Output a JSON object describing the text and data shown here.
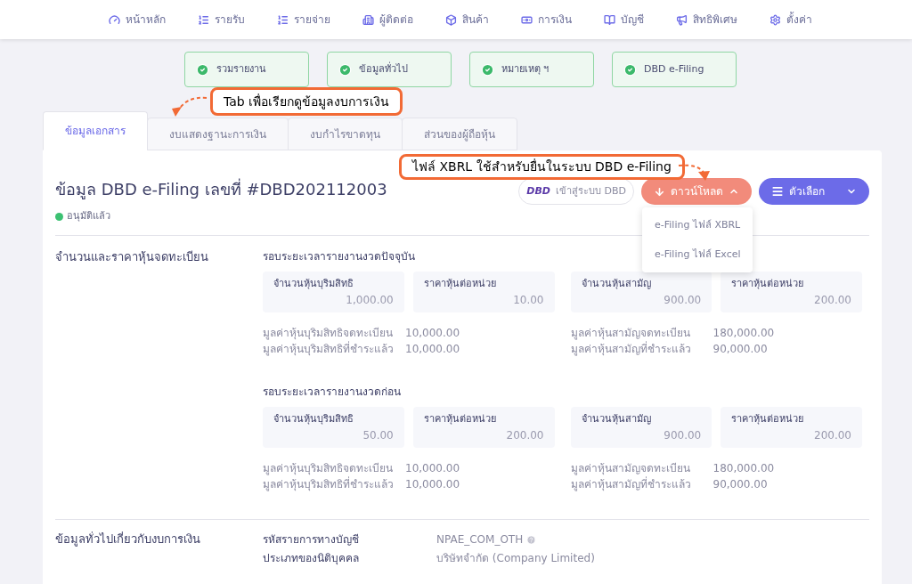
{
  "nav": [
    {
      "label": "หน้าหลัก"
    },
    {
      "label": "รายรับ"
    },
    {
      "label": "รายจ่าย"
    },
    {
      "label": "ผู้ติดต่อ"
    },
    {
      "label": "สินค้า"
    },
    {
      "label": "การเงิน"
    },
    {
      "label": "บัญชี"
    },
    {
      "label": "สิทธิพิเศษ"
    },
    {
      "label": "ตั้งค่า"
    }
  ],
  "steps": [
    {
      "label": "รวมรายงาน",
      "done": true
    },
    {
      "label": "ข้อมูลทั่วไป",
      "done": true
    },
    {
      "label": "หมายเหตุ ฯ",
      "done": true
    },
    {
      "label": "DBD e-Filing",
      "done": true
    }
  ],
  "callouts": [
    {
      "text": "Tab เพื่อเรียกดูข้อมูลงบการเงิน"
    },
    {
      "text": "ไฟล์ XBRL ใช้สำหรับยื่นในระบบ DBD e-Filing"
    }
  ],
  "tabs": [
    {
      "label": "ข้อมูลเอกสาร",
      "selected": true
    },
    {
      "label": "งบแสดงฐานะการเงิน",
      "selected": false
    },
    {
      "label": "งบกำไรขาดทุน",
      "selected": false
    },
    {
      "label": "ส่วนของผู้ถือหุ้น",
      "selected": false
    }
  ],
  "document": {
    "title": "ข้อมูล DBD e-Filing เลขที่ #DBD202112003",
    "status": {
      "label": "อนุมัติแล้ว",
      "color": "#3cc172"
    },
    "dbd_button": {
      "logo": "DBD",
      "label": "เข้าสู่ระบบ DBD"
    },
    "download_button": {
      "label": "ดาวน์โหลด",
      "expanded": true
    },
    "options_button": {
      "label": "ตัวเลือก",
      "expanded": false
    },
    "download_menu": [
      {
        "label": "e-Filing ไฟล์ XBRL"
      },
      {
        "label": "e-Filing ไฟล์ Excel"
      }
    ]
  },
  "share_section": {
    "title": "จำนวนและราคาหุ้นจดทะเบียน",
    "periods": [
      {
        "heading": "รอบระยะเวลารายงานงวดปัจจุบัน",
        "groups": [
          {
            "boxes": [
              {
                "label": "จำนวนหุ้นบุริมสิทธิ",
                "value": "1,000.00"
              },
              {
                "label": "ราคาหุ้นต่อหน่วย",
                "value": "10.00"
              }
            ],
            "rows": [
              {
                "label": "มูลค่าหุ้นบุริมสิทธิจดทะเบียน",
                "value": "10,000.00"
              },
              {
                "label": "มูลค่าหุ้นบุริมสิทธิที่ชำระแล้ว",
                "value": "10,000.00"
              }
            ]
          },
          {
            "boxes": [
              {
                "label": "จำนวนหุ้นสามัญ",
                "value": "900.00"
              },
              {
                "label": "ราคาหุ้นต่อหน่วย",
                "value": "200.00"
              }
            ],
            "rows": [
              {
                "label": "มูลค่าหุ้นสามัญจดทะเบียน",
                "value": "180,000.00"
              },
              {
                "label": "มูลค่าหุ้นสามัญที่ชำระแล้ว",
                "value": "90,000.00"
              }
            ]
          }
        ]
      },
      {
        "heading": "รอบระยะเวลารายงานงวดก่อน",
        "groups": [
          {
            "boxes": [
              {
                "label": "จำนวนหุ้นบุริมสิทธิ",
                "value": "50.00"
              },
              {
                "label": "ราคาหุ้นต่อหน่วย",
                "value": "200.00"
              }
            ],
            "rows": [
              {
                "label": "มูลค่าหุ้นบุริมสิทธิจดทะเบียน",
                "value": "10,000.00"
              },
              {
                "label": "มูลค่าหุ้นบุริมสิทธิที่ชำระแล้ว",
                "value": "10,000.00"
              }
            ]
          },
          {
            "boxes": [
              {
                "label": "จำนวนหุ้นสามัญ",
                "value": "900.00"
              },
              {
                "label": "ราคาหุ้นต่อหน่วย",
                "value": "200.00"
              }
            ],
            "rows": [
              {
                "label": "มูลค่าหุ้นสามัญจดทะเบียน",
                "value": "180,000.00"
              },
              {
                "label": "มูลค่าหุ้นสามัญที่ชำระแล้ว",
                "value": "90,000.00"
              }
            ]
          }
        ]
      }
    ]
  },
  "general_section": {
    "title": "ข้อมูลทั่วไปเกี่ยวกับงบการเงิน",
    "rows": [
      {
        "label": "รหัสรายการทางบัญชี",
        "value": "NPAE_COM_OTH",
        "help": true
      },
      {
        "label": "ประเภทของนิติบุคคล",
        "value": "บริษัทจำกัด (Company Limited)",
        "help": false
      }
    ]
  }
}
